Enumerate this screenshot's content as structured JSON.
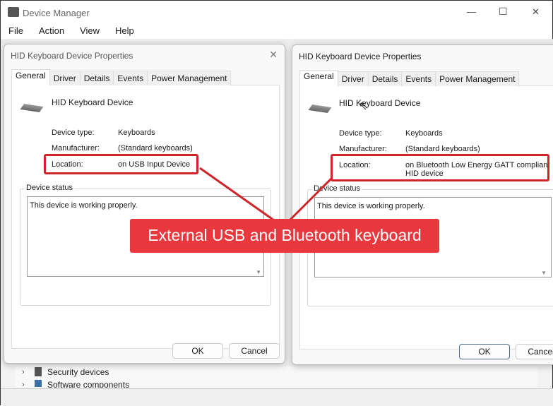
{
  "window": {
    "title": "Device Manager",
    "controls": {
      "minimize": "—",
      "maximize": "☐",
      "close": "✕"
    }
  },
  "menu": [
    "File",
    "Action",
    "View",
    "Help"
  ],
  "tree": [
    "Security devices",
    "Software components"
  ],
  "dialogs": [
    {
      "title": "HID Keyboard Device Properties",
      "tabs": [
        "General",
        "Driver",
        "Details",
        "Events",
        "Power Management"
      ],
      "device_name": "HID Keyboard Device",
      "fields": {
        "type_label": "Device type:",
        "type": "Keyboards",
        "mfr_label": "Manufacturer:",
        "mfr": "(Standard keyboards)",
        "loc_label": "Location:",
        "loc": "on USB Input Device"
      },
      "status_title": "Device status",
      "status": "This device is working properly.",
      "ok": "OK",
      "cancel": "Cancel"
    },
    {
      "title": "HID Keyboard Device Properties",
      "tabs": [
        "General",
        "Driver",
        "Details",
        "Events",
        "Power Management"
      ],
      "device_name": "HID Keyboard Device",
      "fields": {
        "type_label": "Device type:",
        "type": "Keyboards",
        "mfr_label": "Manufacturer:",
        "mfr": "(Standard keyboards)",
        "loc_label": "Location:",
        "loc": "on Bluetooth Low Energy GATT compliant HID device"
      },
      "status_title": "Device status",
      "status": "This device is working properly.",
      "ok": "OK",
      "cancel": "Cancel"
    }
  ],
  "annotation": {
    "text": "External USB and Bluetooth keyboard",
    "color": "#e8373d"
  }
}
